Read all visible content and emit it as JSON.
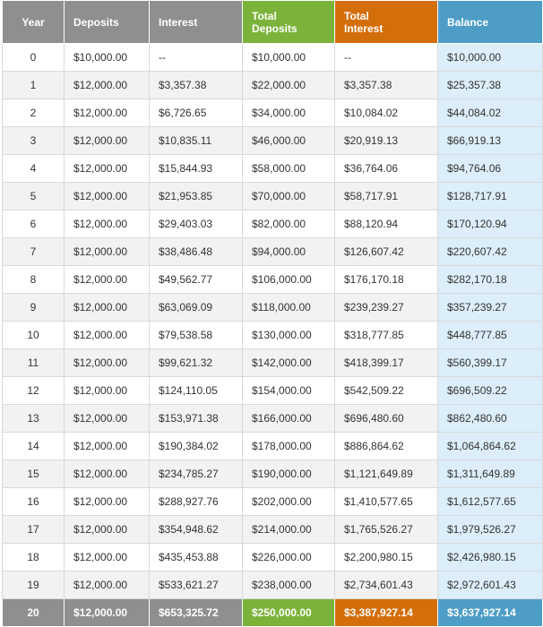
{
  "colors": {
    "header_gray": "#8f8f8f",
    "total_deposits_green": "#7bb33a",
    "total_interest_orange": "#d46e0b",
    "balance_blue": "#4d9dc7",
    "balance_column_tint": "#dbeef9",
    "row_alt": "#f2f2f2"
  },
  "headers": {
    "year": "Year",
    "deposits": "Deposits",
    "interest": "Interest",
    "total_deposits_line1": "Total",
    "total_deposits_line2": "Deposits",
    "total_interest_line1": "Total",
    "total_interest_line2": "Interest",
    "balance": "Balance"
  },
  "rows": [
    {
      "year": "0",
      "deposits": "$10,000.00",
      "interest": "--",
      "total_deposits": "$10,000.00",
      "total_interest": "--",
      "balance": "$10,000.00"
    },
    {
      "year": "1",
      "deposits": "$12,000.00",
      "interest": "$3,357.38",
      "total_deposits": "$22,000.00",
      "total_interest": "$3,357.38",
      "balance": "$25,357.38"
    },
    {
      "year": "2",
      "deposits": "$12,000.00",
      "interest": "$6,726.65",
      "total_deposits": "$34,000.00",
      "total_interest": "$10,084.02",
      "balance": "$44,084.02"
    },
    {
      "year": "3",
      "deposits": "$12,000.00",
      "interest": "$10,835.11",
      "total_deposits": "$46,000.00",
      "total_interest": "$20,919.13",
      "balance": "$66,919.13"
    },
    {
      "year": "4",
      "deposits": "$12,000.00",
      "interest": "$15,844.93",
      "total_deposits": "$58,000.00",
      "total_interest": "$36,764.06",
      "balance": "$94,764.06"
    },
    {
      "year": "5",
      "deposits": "$12,000.00",
      "interest": "$21,953.85",
      "total_deposits": "$70,000.00",
      "total_interest": "$58,717.91",
      "balance": "$128,717.91"
    },
    {
      "year": "6",
      "deposits": "$12,000.00",
      "interest": "$29,403.03",
      "total_deposits": "$82,000.00",
      "total_interest": "$88,120.94",
      "balance": "$170,120.94"
    },
    {
      "year": "7",
      "deposits": "$12,000.00",
      "interest": "$38,486.48",
      "total_deposits": "$94,000.00",
      "total_interest": "$126,607.42",
      "balance": "$220,607.42"
    },
    {
      "year": "8",
      "deposits": "$12,000.00",
      "interest": "$49,562.77",
      "total_deposits": "$106,000.00",
      "total_interest": "$176,170.18",
      "balance": "$282,170.18"
    },
    {
      "year": "9",
      "deposits": "$12,000.00",
      "interest": "$63,069.09",
      "total_deposits": "$118,000.00",
      "total_interest": "$239,239.27",
      "balance": "$357,239.27"
    },
    {
      "year": "10",
      "deposits": "$12,000.00",
      "interest": "$79,538.58",
      "total_deposits": "$130,000.00",
      "total_interest": "$318,777.85",
      "balance": "$448,777.85"
    },
    {
      "year": "11",
      "deposits": "$12,000.00",
      "interest": "$99,621.32",
      "total_deposits": "$142,000.00",
      "total_interest": "$418,399.17",
      "balance": "$560,399.17"
    },
    {
      "year": "12",
      "deposits": "$12,000.00",
      "interest": "$124,110.05",
      "total_deposits": "$154,000.00",
      "total_interest": "$542,509.22",
      "balance": "$696,509.22"
    },
    {
      "year": "13",
      "deposits": "$12,000.00",
      "interest": "$153,971.38",
      "total_deposits": "$166,000.00",
      "total_interest": "$696,480.60",
      "balance": "$862,480.60"
    },
    {
      "year": "14",
      "deposits": "$12,000.00",
      "interest": "$190,384.02",
      "total_deposits": "$178,000.00",
      "total_interest": "$886,864.62",
      "balance": "$1,064,864.62"
    },
    {
      "year": "15",
      "deposits": "$12,000.00",
      "interest": "$234,785.27",
      "total_deposits": "$190,000.00",
      "total_interest": "$1,121,649.89",
      "balance": "$1,311,649.89"
    },
    {
      "year": "16",
      "deposits": "$12,000.00",
      "interest": "$288,927.76",
      "total_deposits": "$202,000.00",
      "total_interest": "$1,410,577.65",
      "balance": "$1,612,577.65"
    },
    {
      "year": "17",
      "deposits": "$12,000.00",
      "interest": "$354,948.62",
      "total_deposits": "$214,000.00",
      "total_interest": "$1,765,526.27",
      "balance": "$1,979,526.27"
    },
    {
      "year": "18",
      "deposits": "$12,000.00",
      "interest": "$435,453.88",
      "total_deposits": "$226,000.00",
      "total_interest": "$2,200,980.15",
      "balance": "$2,426,980.15"
    },
    {
      "year": "19",
      "deposits": "$12,000.00",
      "interest": "$533,621.27",
      "total_deposits": "$238,000.00",
      "total_interest": "$2,734,601.43",
      "balance": "$2,972,601.43"
    }
  ],
  "final_row": {
    "year": "20",
    "deposits": "$12,000.00",
    "interest": "$653,325.72",
    "total_deposits": "$250,000.00",
    "total_interest": "$3,387,927.14",
    "balance": "$3,637,927.14"
  }
}
